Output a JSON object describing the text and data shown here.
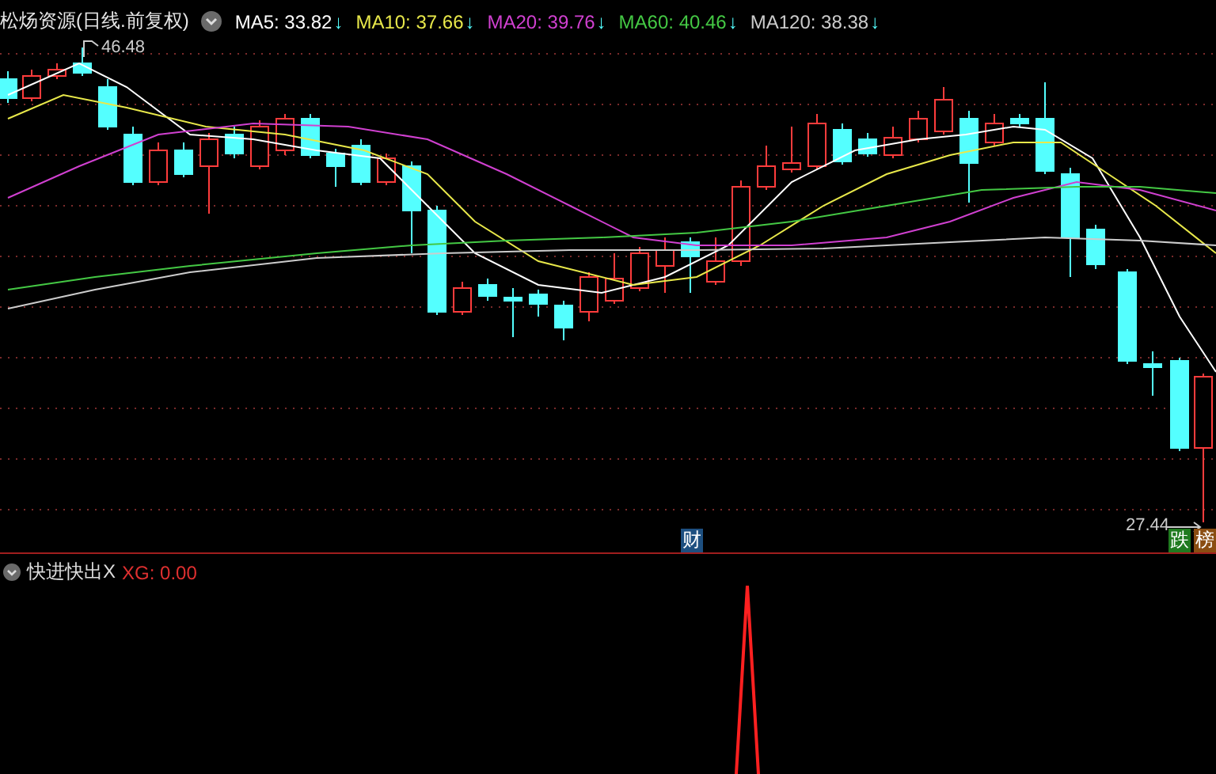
{
  "chart": {
    "title": "松炀资源(日线.前复权)",
    "indicators": [
      {
        "label": "MA5: 33.82",
        "arrow": "↓",
        "color": "#ffffff"
      },
      {
        "label": "MA10: 37.66",
        "arrow": "↓",
        "color": "#e8e84a"
      },
      {
        "label": "MA20: 39.76",
        "arrow": "↓",
        "color": "#d040d0"
      },
      {
        "label": "MA60: 40.46",
        "arrow": "↓",
        "color": "#44c844"
      },
      {
        "label": "MA120: 38.38",
        "arrow": "↓",
        "color": "#cccccc"
      }
    ],
    "high_label": "46.48",
    "low_label": "27.44",
    "badges": [
      {
        "text": "财",
        "kind": "finance"
      },
      {
        "text": "跌",
        "kind": "fall"
      },
      {
        "text": "榜",
        "kind": "list"
      }
    ]
  },
  "indicator_panel": {
    "name": "快进快出X",
    "reading": "XG: 0.00"
  }
}
